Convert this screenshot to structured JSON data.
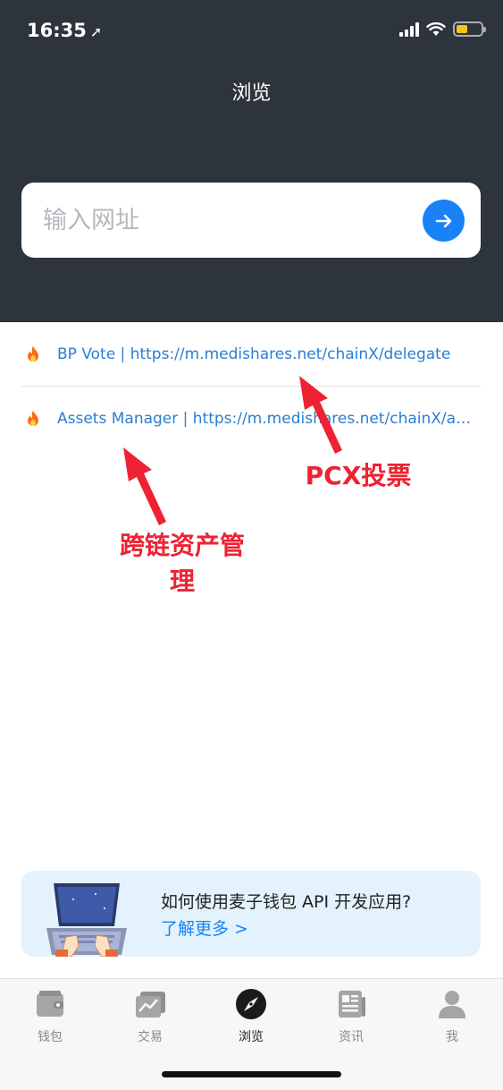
{
  "status_bar": {
    "time": "16:35",
    "location_glyph": "➚"
  },
  "header": {
    "title": "浏览"
  },
  "search": {
    "placeholder": "输入网址"
  },
  "list": [
    {
      "label": "BP Vote | https://m.medishares.net/chainX/delegate"
    },
    {
      "label": "Assets Manager | https://m.medishares.net/chainX/as..."
    }
  ],
  "annotations": {
    "pcx_vote": "PCX投票",
    "cross_chain_asset": "跨链资产管\n理"
  },
  "promo": {
    "title": "如何使用麦子钱包 API 开发应用?",
    "link": "了解更多 >"
  },
  "tabs": [
    {
      "label": "钱包",
      "icon": "wallet-icon"
    },
    {
      "label": "交易",
      "icon": "trade-chart-icon"
    },
    {
      "label": "浏览",
      "icon": "compass-icon",
      "active": true
    },
    {
      "label": "资讯",
      "icon": "news-icon"
    },
    {
      "label": "我",
      "icon": "profile-icon"
    }
  ],
  "colors": {
    "header_bg": "#2d343c",
    "accent": "#1a82f7",
    "link": "#2a7ed2",
    "annotation": "#ee2233",
    "promo_bg": "#e3f2fc"
  }
}
